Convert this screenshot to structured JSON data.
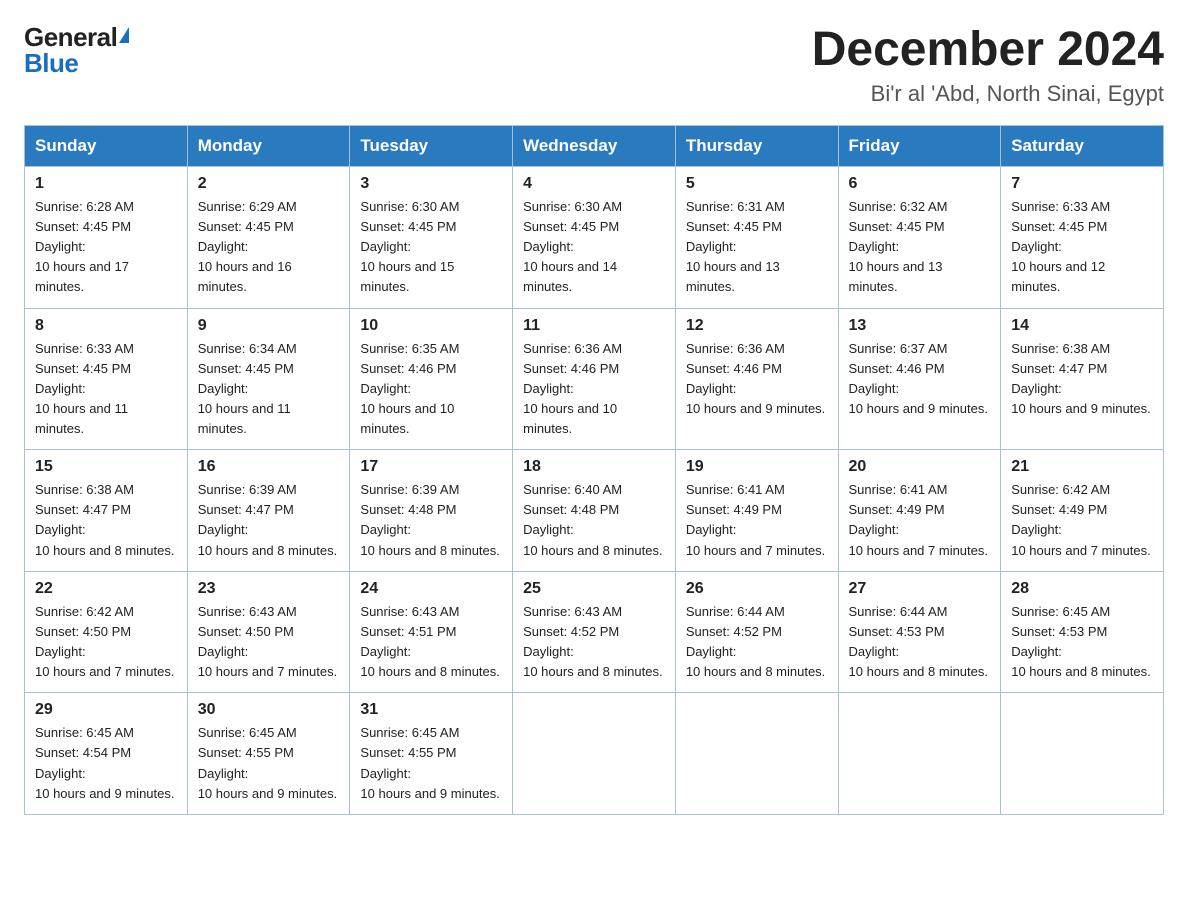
{
  "logo": {
    "general": "General",
    "blue": "Blue",
    "triangle": "▶"
  },
  "title": {
    "month": "December 2024",
    "location": "Bi'r al 'Abd, North Sinai, Egypt"
  },
  "weekdays": [
    "Sunday",
    "Monday",
    "Tuesday",
    "Wednesday",
    "Thursday",
    "Friday",
    "Saturday"
  ],
  "weeks": [
    [
      {
        "day": "1",
        "sunrise": "6:28 AM",
        "sunset": "4:45 PM",
        "daylight": "10 hours and 17 minutes."
      },
      {
        "day": "2",
        "sunrise": "6:29 AM",
        "sunset": "4:45 PM",
        "daylight": "10 hours and 16 minutes."
      },
      {
        "day": "3",
        "sunrise": "6:30 AM",
        "sunset": "4:45 PM",
        "daylight": "10 hours and 15 minutes."
      },
      {
        "day": "4",
        "sunrise": "6:30 AM",
        "sunset": "4:45 PM",
        "daylight": "10 hours and 14 minutes."
      },
      {
        "day": "5",
        "sunrise": "6:31 AM",
        "sunset": "4:45 PM",
        "daylight": "10 hours and 13 minutes."
      },
      {
        "day": "6",
        "sunrise": "6:32 AM",
        "sunset": "4:45 PM",
        "daylight": "10 hours and 13 minutes."
      },
      {
        "day": "7",
        "sunrise": "6:33 AM",
        "sunset": "4:45 PM",
        "daylight": "10 hours and 12 minutes."
      }
    ],
    [
      {
        "day": "8",
        "sunrise": "6:33 AM",
        "sunset": "4:45 PM",
        "daylight": "10 hours and 11 minutes."
      },
      {
        "day": "9",
        "sunrise": "6:34 AM",
        "sunset": "4:45 PM",
        "daylight": "10 hours and 11 minutes."
      },
      {
        "day": "10",
        "sunrise": "6:35 AM",
        "sunset": "4:46 PM",
        "daylight": "10 hours and 10 minutes."
      },
      {
        "day": "11",
        "sunrise": "6:36 AM",
        "sunset": "4:46 PM",
        "daylight": "10 hours and 10 minutes."
      },
      {
        "day": "12",
        "sunrise": "6:36 AM",
        "sunset": "4:46 PM",
        "daylight": "10 hours and 9 minutes."
      },
      {
        "day": "13",
        "sunrise": "6:37 AM",
        "sunset": "4:46 PM",
        "daylight": "10 hours and 9 minutes."
      },
      {
        "day": "14",
        "sunrise": "6:38 AM",
        "sunset": "4:47 PM",
        "daylight": "10 hours and 9 minutes."
      }
    ],
    [
      {
        "day": "15",
        "sunrise": "6:38 AM",
        "sunset": "4:47 PM",
        "daylight": "10 hours and 8 minutes."
      },
      {
        "day": "16",
        "sunrise": "6:39 AM",
        "sunset": "4:47 PM",
        "daylight": "10 hours and 8 minutes."
      },
      {
        "day": "17",
        "sunrise": "6:39 AM",
        "sunset": "4:48 PM",
        "daylight": "10 hours and 8 minutes."
      },
      {
        "day": "18",
        "sunrise": "6:40 AM",
        "sunset": "4:48 PM",
        "daylight": "10 hours and 8 minutes."
      },
      {
        "day": "19",
        "sunrise": "6:41 AM",
        "sunset": "4:49 PM",
        "daylight": "10 hours and 7 minutes."
      },
      {
        "day": "20",
        "sunrise": "6:41 AM",
        "sunset": "4:49 PM",
        "daylight": "10 hours and 7 minutes."
      },
      {
        "day": "21",
        "sunrise": "6:42 AM",
        "sunset": "4:49 PM",
        "daylight": "10 hours and 7 minutes."
      }
    ],
    [
      {
        "day": "22",
        "sunrise": "6:42 AM",
        "sunset": "4:50 PM",
        "daylight": "10 hours and 7 minutes."
      },
      {
        "day": "23",
        "sunrise": "6:43 AM",
        "sunset": "4:50 PM",
        "daylight": "10 hours and 7 minutes."
      },
      {
        "day": "24",
        "sunrise": "6:43 AM",
        "sunset": "4:51 PM",
        "daylight": "10 hours and 8 minutes."
      },
      {
        "day": "25",
        "sunrise": "6:43 AM",
        "sunset": "4:52 PM",
        "daylight": "10 hours and 8 minutes."
      },
      {
        "day": "26",
        "sunrise": "6:44 AM",
        "sunset": "4:52 PM",
        "daylight": "10 hours and 8 minutes."
      },
      {
        "day": "27",
        "sunrise": "6:44 AM",
        "sunset": "4:53 PM",
        "daylight": "10 hours and 8 minutes."
      },
      {
        "day": "28",
        "sunrise": "6:45 AM",
        "sunset": "4:53 PM",
        "daylight": "10 hours and 8 minutes."
      }
    ],
    [
      {
        "day": "29",
        "sunrise": "6:45 AM",
        "sunset": "4:54 PM",
        "daylight": "10 hours and 9 minutes."
      },
      {
        "day": "30",
        "sunrise": "6:45 AM",
        "sunset": "4:55 PM",
        "daylight": "10 hours and 9 minutes."
      },
      {
        "day": "31",
        "sunrise": "6:45 AM",
        "sunset": "4:55 PM",
        "daylight": "10 hours and 9 minutes."
      },
      null,
      null,
      null,
      null
    ]
  ],
  "labels": {
    "sunrise": "Sunrise:",
    "sunset": "Sunset:",
    "daylight": "Daylight:"
  }
}
